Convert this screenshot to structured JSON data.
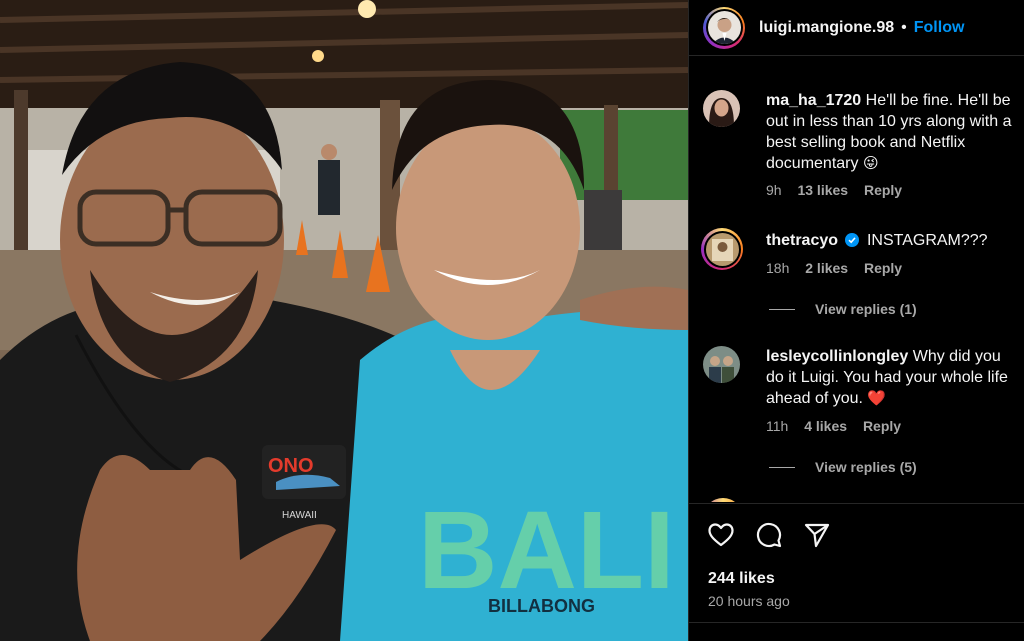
{
  "post": {
    "author": "luigi.mangione.98",
    "separator": "•",
    "follow_label": "Follow",
    "likes": "244 likes",
    "posted": "20 hours ago"
  },
  "photo": {
    "shirt_left_logo": "ONO",
    "shirt_left_sub": "HAWAII",
    "shirt_right_word": "BALI",
    "shirt_right_brand": "BILLABONG"
  },
  "comments": [
    {
      "user": "ma_ha_1720",
      "text": "He'll be fine. He'll be out in less than 10 yrs along with a best selling book and Netflix documentary",
      "emoji": "😜",
      "time": "9h",
      "likes": "13 likes",
      "reply": "Reply"
    },
    {
      "user": "thetracyo",
      "verified": true,
      "text": "INSTAGRAM???",
      "time": "18h",
      "likes": "2 likes",
      "reply": "Reply",
      "view_replies": "View replies (1)"
    },
    {
      "user": "lesleycollinlongley",
      "text": "Why did you do it Luigi. You had your whole life ahead of you.",
      "emoji": "❤️",
      "time": "11h",
      "likes": "4 likes",
      "reply": "Reply",
      "view_replies": "View replies (5)"
    }
  ],
  "icons": {
    "like": "heart-icon",
    "comment": "comment-bubble-icon",
    "share": "paper-plane-icon",
    "verified": "verified-badge-icon"
  },
  "colors": {
    "follow_blue": "#0095f6",
    "verified_blue": "#0095f6",
    "muted_text": "#a8a8a8",
    "panel_bg": "#000000"
  }
}
